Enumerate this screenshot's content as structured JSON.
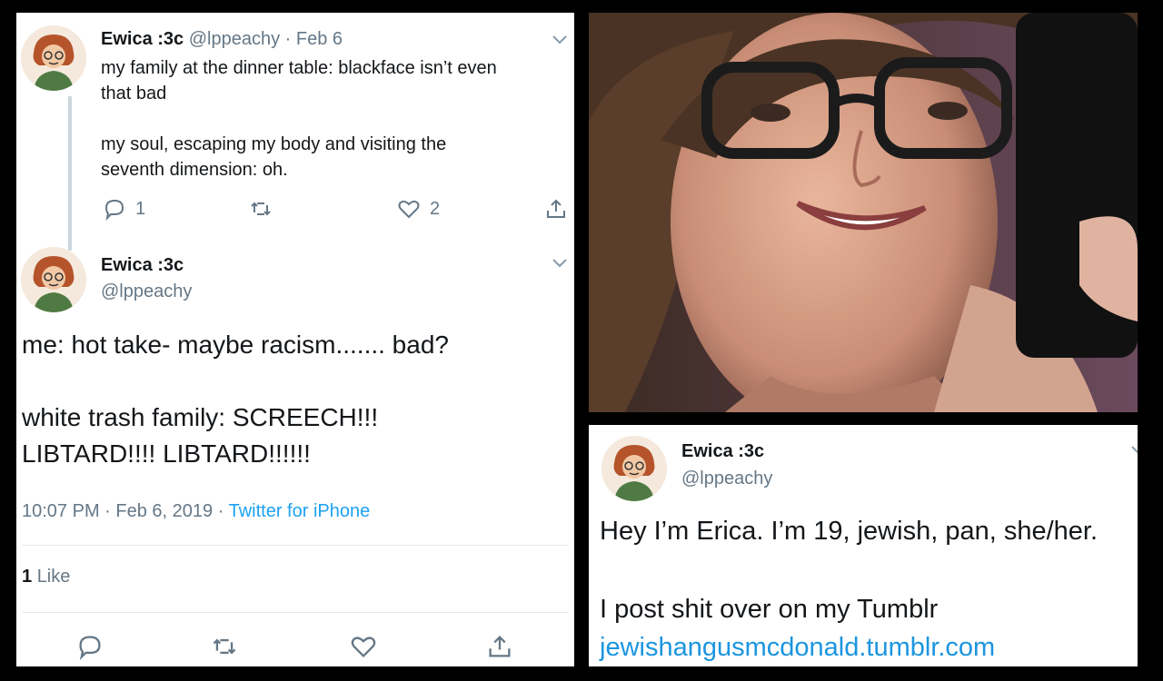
{
  "tweet1": {
    "name": "Ewica :3c",
    "handle": "@lppeachy",
    "sep": "·",
    "date": "Feb 6",
    "text": "my family at the dinner table: blackface isn’t even\nthat bad\n\nmy soul, escaping my body and visiting the\nseventh dimension: oh.",
    "reply_count": "1",
    "like_count": "2",
    "icons": [
      "reply-icon",
      "retweet-icon",
      "like-icon",
      "share-icon"
    ]
  },
  "tweet2": {
    "name": "Ewica :3c",
    "handle": "@lppeachy",
    "text": "me: hot take- maybe racism....... bad?\n\nwhite trash family: SCREECH!!!\nLIBTARD!!!! LIBTARD!!!!!!",
    "time": "10:07 PM",
    "sep1": "·",
    "date": "Feb 6, 2019",
    "sep2": "·",
    "source": "Twitter for iPhone",
    "likes_count": "1",
    "likes_label": "Like"
  },
  "tweet3": {
    "name": "Ewica :3c",
    "handle": "@lppeachy",
    "text": "Hey I’m Erica. I’m 19, jewish, pan, she/her.\n\nI post shit over on my Tumblr",
    "link": "jewishangusmcdonald.tumblr.com"
  },
  "colors": {
    "background": "#000000",
    "text": "#14171a",
    "muted": "#657786",
    "link": "#1b95e0",
    "source": "#1da1f2"
  }
}
